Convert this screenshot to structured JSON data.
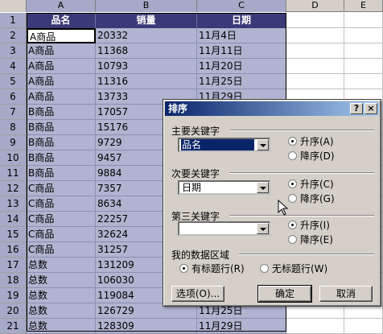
{
  "columns": [
    "A",
    "B",
    "C",
    "D",
    "E"
  ],
  "rows": [
    1,
    2,
    3,
    4,
    5,
    6,
    7,
    8,
    9,
    10,
    11,
    12,
    13,
    14,
    15,
    16,
    17,
    18,
    19,
    20,
    21
  ],
  "table": {
    "headers": [
      "品名",
      "销量",
      "日期"
    ],
    "data": [
      [
        "A商品",
        "20332",
        "11月4日"
      ],
      [
        "A商品",
        "11368",
        "11月11日"
      ],
      [
        "A商品",
        "10793",
        "11月20日"
      ],
      [
        "A商品",
        "11316",
        "11月25日"
      ],
      [
        "A商品",
        "13733",
        "11月29日"
      ],
      [
        "B商品",
        "17057",
        ""
      ],
      [
        "B商品",
        "15176",
        ""
      ],
      [
        "B商品",
        "9729",
        ""
      ],
      [
        "B商品",
        "9457",
        ""
      ],
      [
        "B商品",
        "9884",
        ""
      ],
      [
        "C商品",
        "7357",
        ""
      ],
      [
        "C商品",
        "8634",
        ""
      ],
      [
        "C商品",
        "22257",
        ""
      ],
      [
        "C商品",
        "32624",
        ""
      ],
      [
        "C商品",
        "31257",
        ""
      ],
      [
        "总数",
        "131209",
        ""
      ],
      [
        "总数",
        "106030",
        ""
      ],
      [
        "总数",
        "119084",
        ""
      ],
      [
        "总数",
        "126729",
        "11月25日"
      ],
      [
        "总数",
        "128309",
        "11月29日"
      ]
    ]
  },
  "dialog": {
    "title": "排序",
    "help_btn": "?",
    "close_btn": "×",
    "key1_label": "主要关键字",
    "key1_value": "品名",
    "key2_label": "次要关键字",
    "key2_value": "日期",
    "key3_label": "第三关键字",
    "key3_value": "",
    "asc_a": "升序(A)",
    "desc_d": "降序(D)",
    "asc_c": "升序(C)",
    "desc_g": "降序(G)",
    "asc_i": "升序(I)",
    "desc_e": "降序(E)",
    "range_label": "我的数据区域",
    "has_header": "有标题行(R)",
    "no_header": "无标题行(W)",
    "options_btn": "选项(O)...",
    "ok_btn": "确定",
    "cancel_btn": "取消"
  }
}
